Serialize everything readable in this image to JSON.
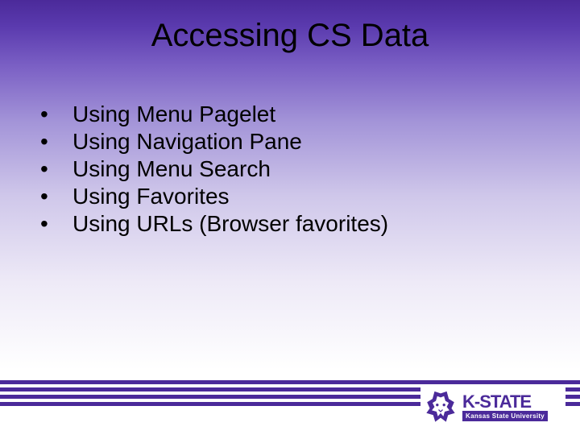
{
  "title": "Accessing CS Data",
  "bullets": [
    "Using Menu Pagelet",
    "Using Navigation Pane",
    "Using Menu Search",
    "Using Favorites",
    "Using URLs (Browser favorites)"
  ],
  "logo": {
    "main": "K-STATE",
    "sub": "Kansas State University"
  },
  "colors": {
    "accent": "#4b2a9a"
  }
}
